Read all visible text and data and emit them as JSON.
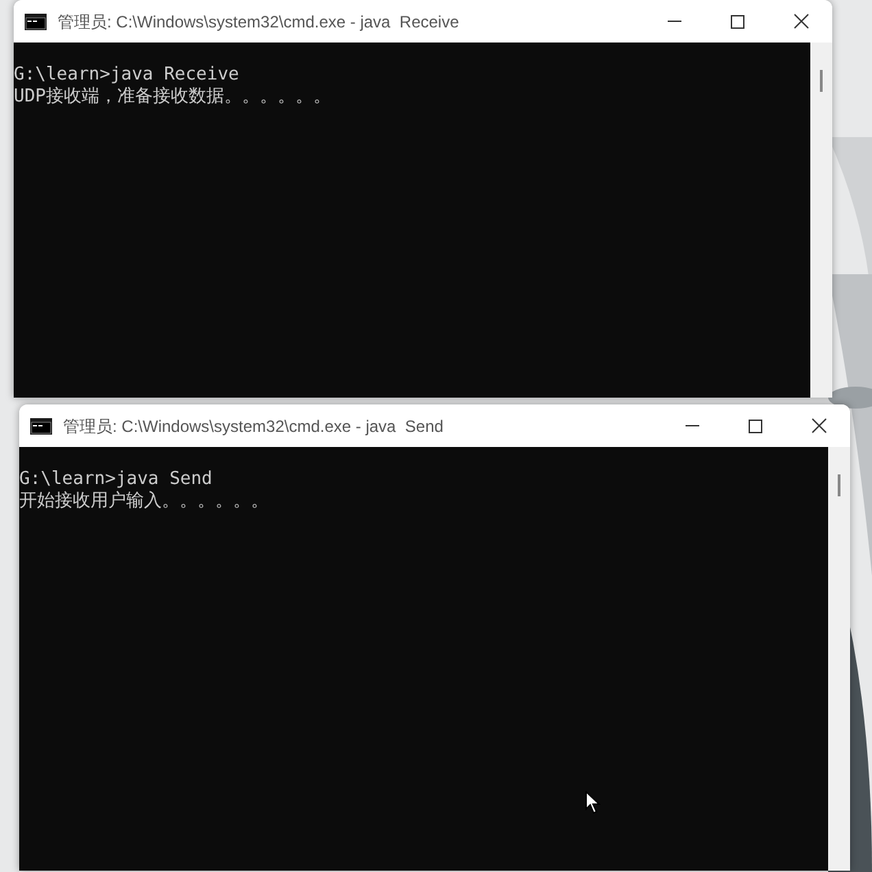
{
  "windows": [
    {
      "title": "管理员: C:\\Windows\\system32\\cmd.exe - java  Receive",
      "lines": [
        "G:\\learn>java Receive",
        "UDP接收端，准备接收数据。。。。。。"
      ]
    },
    {
      "title": "管理员: C:\\Windows\\system32\\cmd.exe - java  Send",
      "lines": [
        "G:\\learn>java Send",
        "开始接收用户输入。。。。。。"
      ]
    }
  ]
}
